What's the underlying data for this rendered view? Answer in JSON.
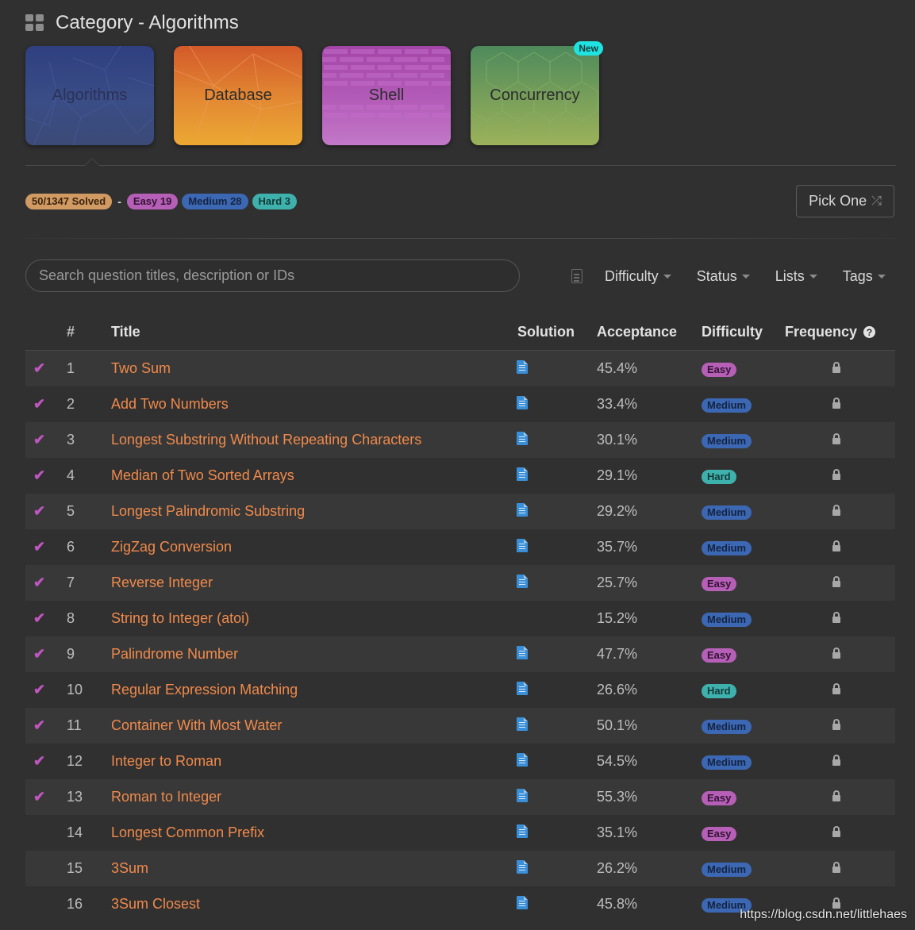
{
  "header": {
    "title": "Category - Algorithms"
  },
  "categories": [
    {
      "label": "Algorithms"
    },
    {
      "label": "Database"
    },
    {
      "label": "Shell"
    },
    {
      "label": "Concurrency",
      "badge": "New"
    }
  ],
  "stats": {
    "solved": "50/1347 Solved",
    "separator": "-",
    "easy": "Easy 19",
    "medium": "Medium 28",
    "hard": "Hard 3"
  },
  "pick_one": {
    "label": "Pick One",
    "icon": "shuffle-icon"
  },
  "search": {
    "placeholder": "Search question titles, description or IDs",
    "value": ""
  },
  "filters": [
    "Difficulty",
    "Status",
    "Lists",
    "Tags"
  ],
  "columns": {
    "num": "#",
    "title": "Title",
    "solution": "Solution",
    "acceptance": "Acceptance",
    "difficulty": "Difficulty",
    "frequency": "Frequency"
  },
  "colors": {
    "link": "#f08a4b",
    "check": "#c055c0",
    "easy": "#b55fb6",
    "medium": "#3c67b3",
    "hard": "#3fb1ad",
    "solved": "#d19a63"
  },
  "problems": [
    {
      "solved": true,
      "id": "1",
      "title": "Two Sum",
      "solution": true,
      "acceptance": "45.4%",
      "difficulty": "Easy"
    },
    {
      "solved": true,
      "id": "2",
      "title": "Add Two Numbers",
      "solution": true,
      "acceptance": "33.4%",
      "difficulty": "Medium"
    },
    {
      "solved": true,
      "id": "3",
      "title": "Longest Substring Without Repeating Characters",
      "solution": true,
      "acceptance": "30.1%",
      "difficulty": "Medium"
    },
    {
      "solved": true,
      "id": "4",
      "title": "Median of Two Sorted Arrays",
      "solution": true,
      "acceptance": "29.1%",
      "difficulty": "Hard"
    },
    {
      "solved": true,
      "id": "5",
      "title": "Longest Palindromic Substring",
      "solution": true,
      "acceptance": "29.2%",
      "difficulty": "Medium"
    },
    {
      "solved": true,
      "id": "6",
      "title": "ZigZag Conversion",
      "solution": true,
      "acceptance": "35.7%",
      "difficulty": "Medium"
    },
    {
      "solved": true,
      "id": "7",
      "title": "Reverse Integer",
      "solution": true,
      "acceptance": "25.7%",
      "difficulty": "Easy"
    },
    {
      "solved": true,
      "id": "8",
      "title": "String to Integer (atoi)",
      "solution": false,
      "acceptance": "15.2%",
      "difficulty": "Medium"
    },
    {
      "solved": true,
      "id": "9",
      "title": "Palindrome Number",
      "solution": true,
      "acceptance": "47.7%",
      "difficulty": "Easy"
    },
    {
      "solved": true,
      "id": "10",
      "title": "Regular Expression Matching",
      "solution": true,
      "acceptance": "26.6%",
      "difficulty": "Hard"
    },
    {
      "solved": true,
      "id": "11",
      "title": "Container With Most Water",
      "solution": true,
      "acceptance": "50.1%",
      "difficulty": "Medium"
    },
    {
      "solved": true,
      "id": "12",
      "title": "Integer to Roman",
      "solution": true,
      "acceptance": "54.5%",
      "difficulty": "Medium"
    },
    {
      "solved": true,
      "id": "13",
      "title": "Roman to Integer",
      "solution": true,
      "acceptance": "55.3%",
      "difficulty": "Easy"
    },
    {
      "solved": false,
      "id": "14",
      "title": "Longest Common Prefix",
      "solution": true,
      "acceptance": "35.1%",
      "difficulty": "Easy"
    },
    {
      "solved": false,
      "id": "15",
      "title": "3Sum",
      "solution": true,
      "acceptance": "26.2%",
      "difficulty": "Medium"
    },
    {
      "solved": false,
      "id": "16",
      "title": "3Sum Closest",
      "solution": true,
      "acceptance": "45.8%",
      "difficulty": "Medium"
    }
  ],
  "watermark": "https://blog.csdn.net/littlehaes"
}
